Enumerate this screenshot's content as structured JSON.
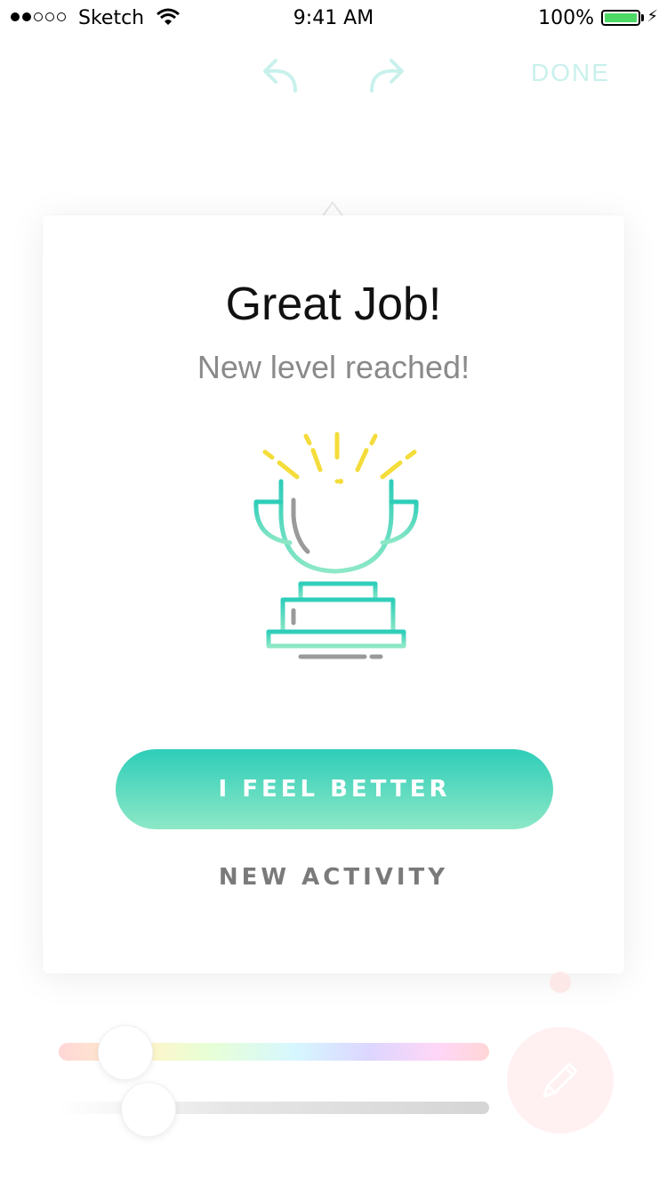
{
  "status_bar": {
    "carrier": "Sketch",
    "time": "9:41 AM",
    "battery_percent": "100%",
    "signal_bars_filled": 2,
    "signal_bars_total": 5
  },
  "toolbar": {
    "undo_icon": "undo-arrow-icon",
    "redo_icon": "redo-arrow-icon",
    "done_label": "DONE"
  },
  "modal": {
    "title": "Great Job!",
    "subtitle": "New level reached!",
    "illustration": "trophy-icon",
    "primary_button": "I FEEL BETTER",
    "secondary_button": "NEW ACTIVITY"
  },
  "bottom_controls": {
    "hue_slider_icon": "color-slider",
    "opacity_slider_icon": "gray-slider",
    "fab_icon": "pencil-icon"
  },
  "colors": {
    "accent_teal": "#2ecdb9",
    "accent_mint": "#8de8c6",
    "trophy_yellow": "#f4dc3a",
    "battery_green": "#4cd964"
  }
}
